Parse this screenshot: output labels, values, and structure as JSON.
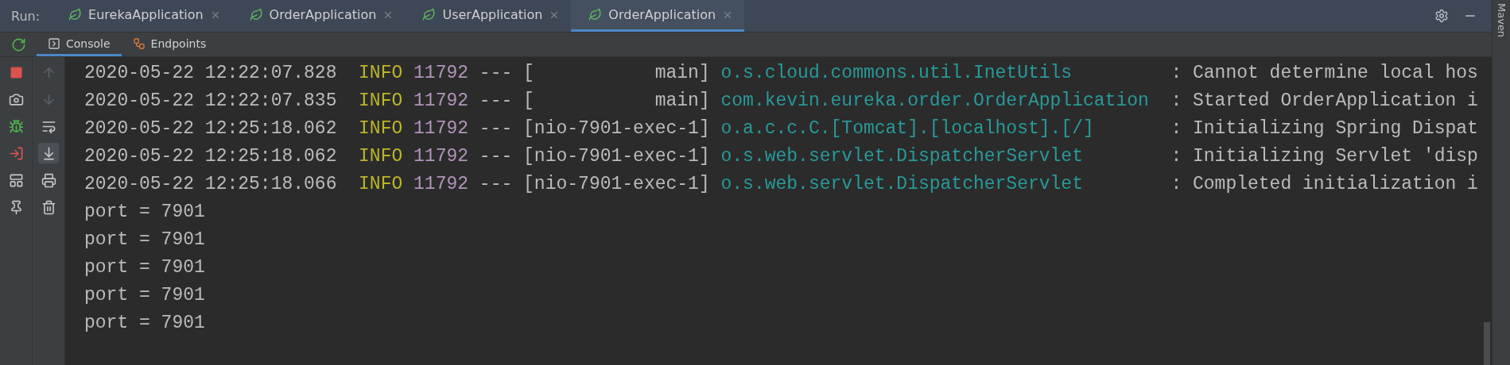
{
  "run_bar": {
    "label": "Run:",
    "tabs": [
      {
        "label": "EurekaApplication",
        "selected": false
      },
      {
        "label": "OrderApplication",
        "selected": false
      },
      {
        "label": "UserApplication",
        "selected": false
      },
      {
        "label": "OrderApplication",
        "selected": true
      }
    ]
  },
  "console_tabs": [
    {
      "kind": "console",
      "label": "Console",
      "selected": true
    },
    {
      "kind": "endpoints",
      "label": "Endpoints",
      "selected": false
    }
  ],
  "side_tools": [
    {
      "kind": "stop"
    },
    {
      "kind": "camera"
    },
    {
      "kind": "debug"
    },
    {
      "kind": "exit"
    },
    {
      "kind": "layout"
    },
    {
      "kind": "pin"
    }
  ],
  "console_tools": [
    {
      "kind": "up",
      "disabled": true,
      "on": false
    },
    {
      "kind": "down",
      "disabled": true,
      "on": false
    },
    {
      "kind": "wrap",
      "disabled": false,
      "on": false
    },
    {
      "kind": "scroll-end",
      "disabled": false,
      "on": true
    },
    {
      "kind": "print",
      "disabled": false,
      "on": false
    },
    {
      "kind": "trash",
      "disabled": false,
      "on": false
    }
  ],
  "log_lines": [
    {
      "kind": "log",
      "timestamp": "2020-05-22 12:22:07.828",
      "level": "INFO",
      "pid": "11792",
      "separator": "---",
      "thread": "[           main]",
      "logger": "o.s.cloud.commons.util.InetUtils",
      "message": ": Cannot determine local hos"
    },
    {
      "kind": "log",
      "timestamp": "2020-05-22 12:22:07.835",
      "level": "INFO",
      "pid": "11792",
      "separator": "---",
      "thread": "[           main]",
      "logger": "com.kevin.eureka.order.OrderApplication",
      "message": ": Started OrderApplication i"
    },
    {
      "kind": "log",
      "timestamp": "2020-05-22 12:25:18.062",
      "level": "INFO",
      "pid": "11792",
      "separator": "---",
      "thread": "[nio-7901-exec-1]",
      "logger": "o.a.c.c.C.[Tomcat].[localhost].[/]",
      "message": ": Initializing Spring Dispat"
    },
    {
      "kind": "log",
      "timestamp": "2020-05-22 12:25:18.062",
      "level": "INFO",
      "pid": "11792",
      "separator": "---",
      "thread": "[nio-7901-exec-1]",
      "logger": "o.s.web.servlet.DispatcherServlet",
      "message": ": Initializing Servlet 'disp"
    },
    {
      "kind": "log",
      "timestamp": "2020-05-22 12:25:18.066",
      "level": "INFO",
      "pid": "11792",
      "separator": "---",
      "thread": "[nio-7901-exec-1]",
      "logger": "o.s.web.servlet.DispatcherServlet",
      "message": ": Completed initialization i"
    },
    {
      "kind": "plain",
      "text": "port = 7901"
    },
    {
      "kind": "plain",
      "text": "port = 7901"
    },
    {
      "kind": "plain",
      "text": "port = 7901"
    },
    {
      "kind": "plain",
      "text": "port = 7901"
    },
    {
      "kind": "plain",
      "text": "port = 7901"
    }
  ],
  "side_strip": {
    "label": "Maven"
  }
}
